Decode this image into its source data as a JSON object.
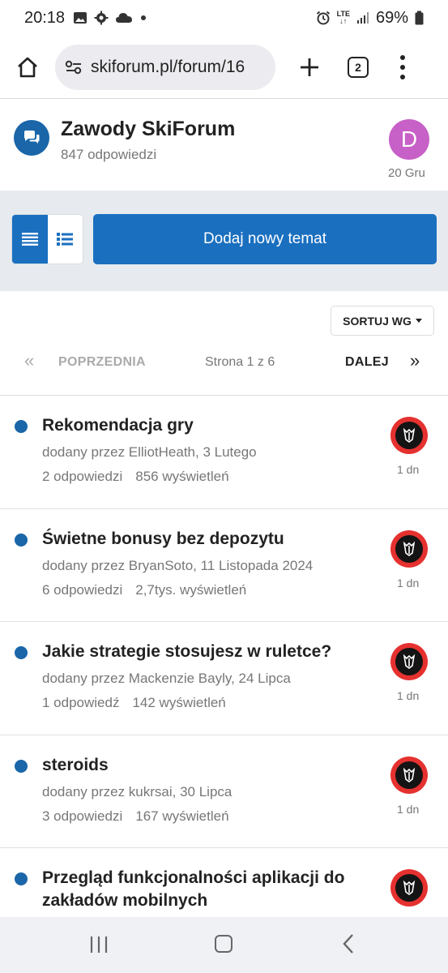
{
  "status_bar": {
    "time": "20:18",
    "network": "LTE",
    "battery": "69%"
  },
  "browser": {
    "url": "skiforum.pl/forum/16",
    "tab_count": "2"
  },
  "category": {
    "title": "Zawody SkiForum",
    "subtitle": "847 odpowiedzi",
    "avatar_letter": "D",
    "last_post_date": "20 Gru",
    "avatar_color": "#c760c7"
  },
  "toolbar": {
    "new_topic_label": "Dodaj nowy temat"
  },
  "sort": {
    "label": "SORTUJ WG"
  },
  "pagination": {
    "first": "«",
    "prev": "POPRZEDNIA",
    "info": "Strona 1 z 6",
    "next": "DALEJ",
    "last": "»"
  },
  "topics": [
    {
      "title": "Rekomendacja gry",
      "meta": "dodany przez ElliotHeath, 3 Lutego",
      "replies": "2 odpowiedzi",
      "views": "856 wyświetleń",
      "age": "1 dn"
    },
    {
      "title": "Świetne bonusy bez depozytu",
      "meta": "dodany przez BryanSoto, 11 Listopada 2024",
      "replies": "6 odpowiedzi",
      "views": "2,7tys. wyświetleń",
      "age": "1 dn"
    },
    {
      "title": "Jakie strategie stosujesz w ruletce?",
      "meta": "dodany przez Mackenzie Bayly, 24 Lipca",
      "replies": "1 odpowiedź",
      "views": "142 wyświetleń",
      "age": "1 dn"
    },
    {
      "title": "steroids",
      "meta": "dodany przez kukrsai, 30 Lipca",
      "replies": "3 odpowiedzi",
      "views": "167 wyświetleń",
      "age": "1 dn"
    },
    {
      "title": "Przegląd funkcjonalności aplikacji do zakładów mobilnych",
      "meta": "",
      "replies": "",
      "views": "",
      "age": ""
    }
  ],
  "colors": {
    "accent": "#1a6fbf",
    "unread_dot": "#1a66a8",
    "toolbar_bg": "#e7ebef"
  }
}
